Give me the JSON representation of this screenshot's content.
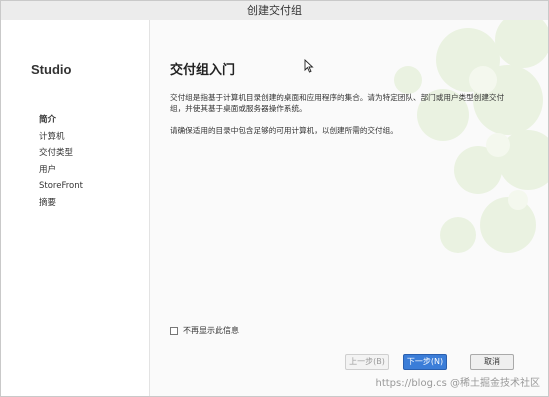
{
  "window": {
    "title": "创建交付组"
  },
  "sidebar": {
    "brand": "Studio",
    "items": [
      {
        "label": "简介",
        "active": true
      },
      {
        "label": "计算机",
        "active": false
      },
      {
        "label": "交付类型",
        "active": false
      },
      {
        "label": "用户",
        "active": false
      },
      {
        "label": "StoreFront",
        "active": false
      },
      {
        "label": "摘要",
        "active": false
      }
    ]
  },
  "main": {
    "heading": "交付组入门",
    "paragraph1": "交付组是指基于计算机目录创建的桌面和应用程序的集合。请为特定团队、部门或用户类型创建交付组，并使其基于桌面或服务器操作系统。",
    "paragraph2": "请确保适用的目录中包含足够的可用计算机，以创建所需的交付组。",
    "checkbox_label": "不再显示此信息"
  },
  "buttons": {
    "prev": "上一步(B)",
    "next": "下一步(N)",
    "cancel": "取消"
  },
  "watermark": "https://blog.cs @稀土掘金技术社区",
  "colors": {
    "accent_button": "#3b7dd8",
    "decoration": "#e8f2dc"
  }
}
